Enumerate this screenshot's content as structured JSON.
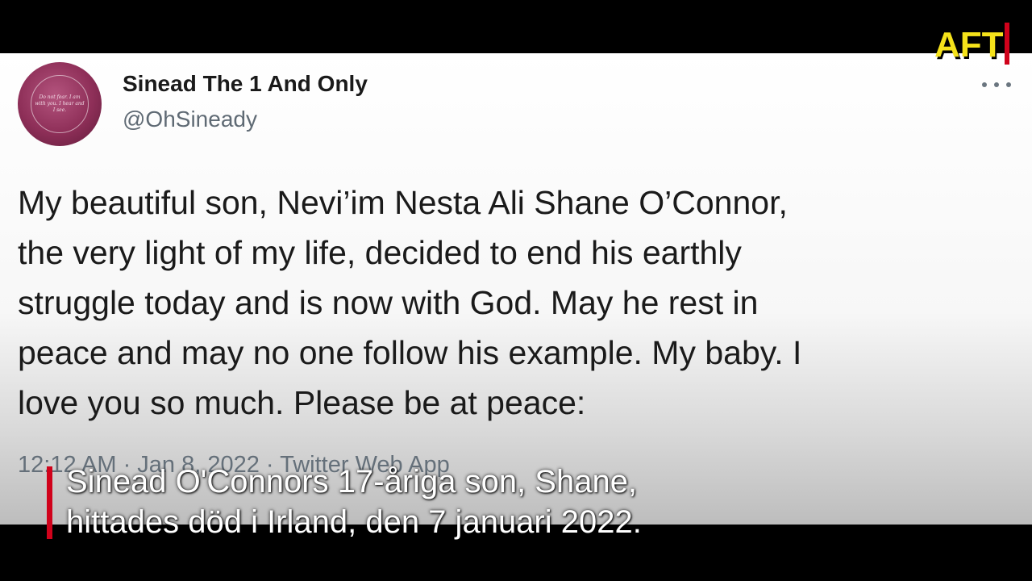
{
  "tweet": {
    "display_name": "Sinead The 1 And Only",
    "handle": "@OhSineady",
    "avatar_text": "Do not fear. I am with you. I hear and I see.",
    "body": "My beautiful son, Nevi’im Nesta Ali Shane O’Connor,\nthe very light of my life, decided to end his earthly\nstruggle today and is now with God. May he rest in\npeace and may no one follow his example.  My baby. I\nlove you so much. Please be at peace:",
    "meta": "12:12 AM · Jan 8, 2022 · Twitter Web App",
    "more_icon": "more-dots-icon"
  },
  "logo": {
    "text": "AFT",
    "text_color": "#f5e21a",
    "accent_color": "#d0021b"
  },
  "caption": {
    "line1": "Sinead O'Connors 17-åriga son, Shane,",
    "line2": "hittades död i Irland, den 7 januari 2022.",
    "accent_color": "#d0021b"
  }
}
